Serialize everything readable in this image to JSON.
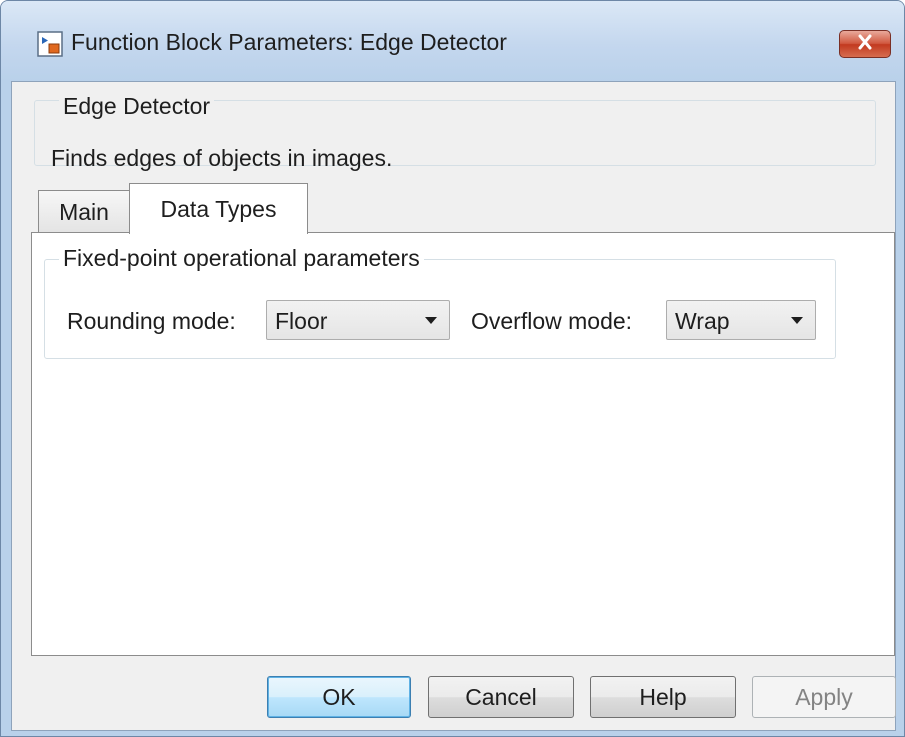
{
  "window": {
    "title": "Function Block Parameters: Edge Detector"
  },
  "description": {
    "heading": "Edge Detector",
    "text": "Finds edges of objects in images."
  },
  "tabs": [
    {
      "label": "Main",
      "selected": false
    },
    {
      "label": "Data Types",
      "selected": true
    }
  ],
  "fixed_point": {
    "group_title": "Fixed-point operational parameters",
    "rounding_label": "Rounding mode:",
    "rounding_value": "Floor",
    "overflow_label": "Overflow mode:",
    "overflow_value": "Wrap"
  },
  "buttons": {
    "ok": "OK",
    "cancel": "Cancel",
    "help": "Help",
    "apply": "Apply",
    "apply_enabled": false
  },
  "icons": {
    "title": "simulink-block-icon",
    "close": "close-icon",
    "dropdown": "chevron-down-icon"
  },
  "colors": {
    "window_frame": "#b9d1ea",
    "close_button": "#c2391f",
    "default_button_border": "#3c7fb1"
  }
}
